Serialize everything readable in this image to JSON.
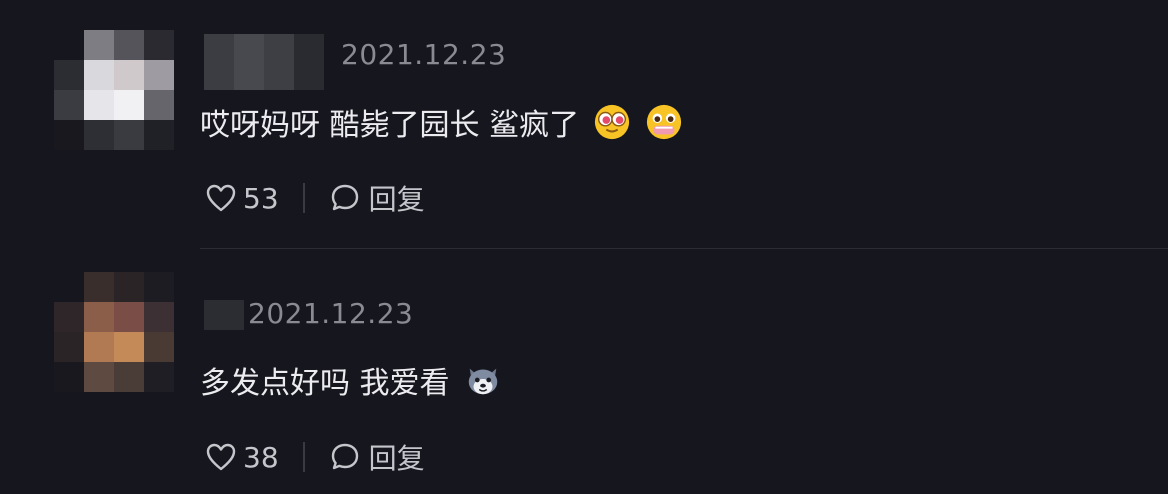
{
  "comments": [
    {
      "date": "2021.12.23",
      "text": "哎呀妈呀 酷毙了园长 鲨疯了",
      "emojis": [
        "heart-eyes-emoji",
        "pleading-tears-emoji"
      ],
      "likes": "53",
      "reply_label": "回复"
    },
    {
      "date": "2021.12.23",
      "text": "多发点好吗 我爱看",
      "emojis": [
        "husky-dog-emoji"
      ],
      "likes": "38",
      "reply_label": "回复"
    }
  ],
  "colors": {
    "background": "#16161e",
    "text_primary": "#ececf0",
    "text_secondary": "#8a8a92",
    "icon": "#c5c5cc"
  }
}
